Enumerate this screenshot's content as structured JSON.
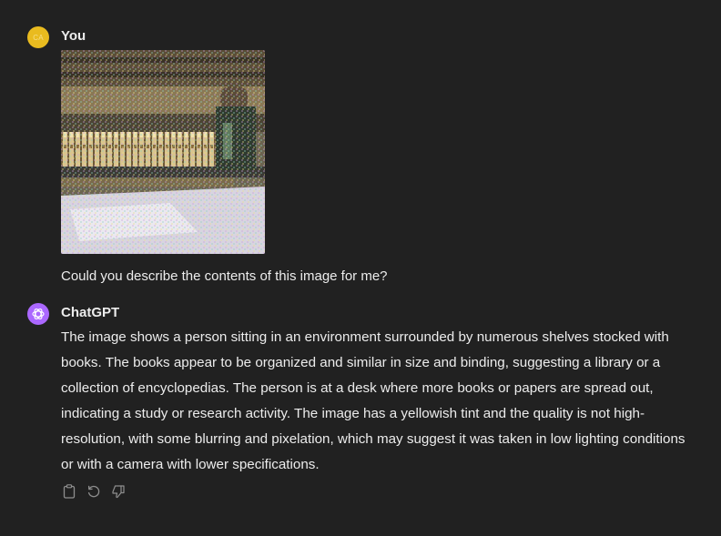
{
  "user": {
    "avatar_initials": "CA",
    "name": "You",
    "message": "Could you describe the contents of this image for me?",
    "attachment_icon": "image-thumbnail"
  },
  "assistant": {
    "name": "ChatGPT",
    "avatar_icon": "openai-logo-icon",
    "message": "The image shows a person sitting in an environment surrounded by numerous shelves stocked with books. The books appear to be organized and similar in size and binding, suggesting a library or a collection of encyclopedias. The person is at a desk where more books or papers are spread out, indicating a study or research activity. The image has a yellowish tint and the quality is not high-resolution, with some blurring and pixelation, which may suggest it was taken in low lighting conditions or with a camera with lower specifications."
  },
  "actions": [
    {
      "icon": "clipboard-icon"
    },
    {
      "icon": "regenerate-icon"
    },
    {
      "icon": "thumbs-down-icon"
    }
  ],
  "colors": {
    "background": "#212121",
    "text": "#ececec",
    "user_avatar": "#e9bb1f",
    "assistant_avatar": "#ab68ff",
    "icon_gray": "#8e8e8e"
  }
}
